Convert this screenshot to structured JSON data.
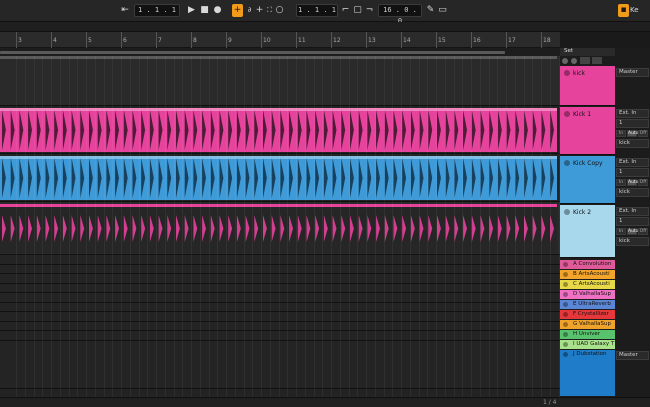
{
  "transport": {
    "position_left": "1 .  1 .  1",
    "position_right": "1 .  1 .  1",
    "loop_length": "16 .  0 .  0",
    "play_icon": "play-icon",
    "stop_icon": "stop-icon",
    "record_icon": "record-icon",
    "key_label": "Ke"
  },
  "ruler": {
    "ticks": [
      "3",
      "4",
      "5",
      "6",
      "7",
      "8",
      "9",
      "10",
      "11",
      "12",
      "13",
      "14",
      "15",
      "16",
      "17",
      "18"
    ]
  },
  "tracks": [
    {
      "name": "kick",
      "color": "#e6439c",
      "output": "Master"
    },
    {
      "name": "Kick 1",
      "color": "#e6439c",
      "input": "Ext. In",
      "channel": "1",
      "monitor": [
        "In",
        "Auto",
        "Off"
      ],
      "route": "kick"
    },
    {
      "name": "Kick Copy",
      "color": "#3f9ad8",
      "input": "Ext. In",
      "channel": "1",
      "monitor": [
        "In",
        "Auto",
        "Off"
      ],
      "route": "kick"
    },
    {
      "name": "Kick 2",
      "color": "#a8d8ec",
      "input": "Ext. In",
      "channel": "1",
      "monitor": [
        "In",
        "Auto",
        "Off"
      ],
      "route": "kick"
    }
  ],
  "returns": [
    {
      "name": "A Convolution",
      "color": "#e05a9a"
    },
    {
      "name": "B ArtsAcousti",
      "color": "#f2a52a"
    },
    {
      "name": "C ArtsAcousti",
      "color": "#e7d848"
    },
    {
      "name": "D ValhallaSup",
      "color": "#f071c4"
    },
    {
      "name": "E UltraReverb",
      "color": "#5b86d6"
    },
    {
      "name": "F Crystallizer",
      "color": "#e6373a"
    },
    {
      "name": "G ValhallaSup",
      "color": "#f0a32a"
    },
    {
      "name": "H Unviver",
      "color": "#58c26c"
    },
    {
      "name": "I UAD Galaxy T",
      "color": "#a8e28a"
    },
    {
      "name": "J Dubstation",
      "color": "#9f8fe0",
      "output": "Master"
    }
  ],
  "master": {
    "name": "Master",
    "color": "#3f9ad8",
    "value": "1/2"
  },
  "set_label": "Set",
  "status": {
    "pos": "1 / 4"
  },
  "colors": {
    "accent": "#f29a1a",
    "pink": "#e6439c",
    "blue": "#3f9ad8",
    "lightblue": "#a8d8ec"
  }
}
